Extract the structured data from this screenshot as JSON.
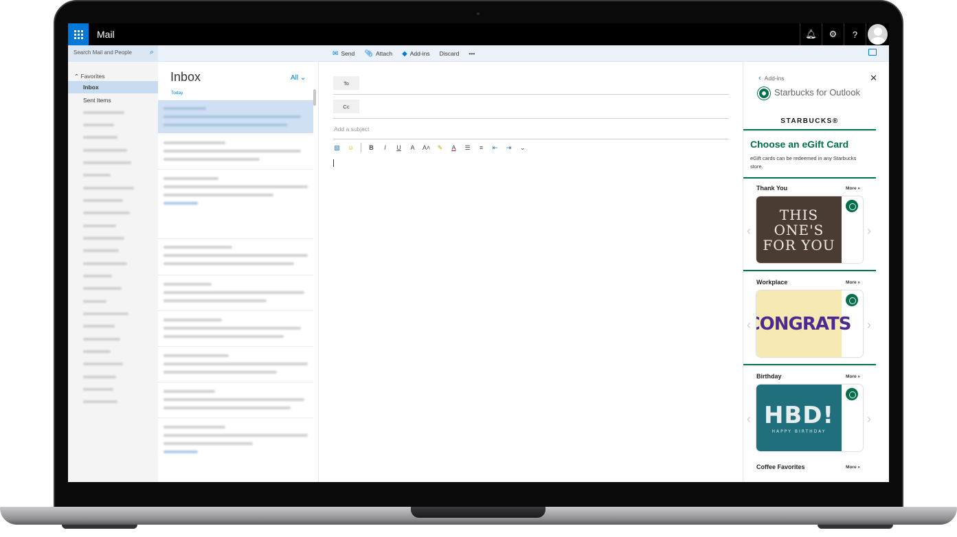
{
  "appbar": {
    "app_name": "Mail",
    "bell_icon": "bell-icon",
    "settings_icon": "gear-icon",
    "help_label": "?"
  },
  "search": {
    "placeholder": "Search Mail and People"
  },
  "commands": {
    "send": "Send",
    "attach": "Attach",
    "addins": "Add-ins",
    "discard": "Discard",
    "more": "•••"
  },
  "folders": {
    "favorites_label": "Favorites",
    "items": [
      {
        "label": "Inbox",
        "active": true
      },
      {
        "label": "Sent Items",
        "active": false
      }
    ]
  },
  "message_list": {
    "title": "Inbox",
    "filter": "All",
    "group_today": "Today"
  },
  "compose": {
    "to_label": "To",
    "cc_label": "Cc",
    "subject_placeholder": "Add a subject",
    "format_tools": [
      "insert-picture-icon",
      "emoji-icon",
      "bold",
      "italic",
      "underline",
      "font-size-icon",
      "grow-font-icon",
      "highlight-icon",
      "font-color-icon",
      "bullets-icon",
      "numbering-icon",
      "decrease-indent-icon",
      "increase-indent-icon",
      "more-options-chevron"
    ]
  },
  "addin": {
    "back_label": "Add-ins",
    "title": "Starbucks for Outlook",
    "brand": "STARBUCKS®",
    "hero_title": "Choose an eGift Card",
    "hero_subtitle": "eGift cards can be redeemed in any Starbucks store.",
    "categories": [
      {
        "name": "Thank You",
        "more": "More »"
      },
      {
        "name": "Workplace",
        "more": "More »"
      },
      {
        "name": "Birthday",
        "more": "More »"
      },
      {
        "name": "Coffee Favorites",
        "more": "More »"
      }
    ],
    "card_art": {
      "thanks": "THIS ONE'S FOR YOU",
      "congrats": "CONGRATS",
      "hbd": "HBD!",
      "hbd_small": "HAPPY BIRTHDAY"
    }
  },
  "colors": {
    "accent": "#0078d7",
    "starbucks_green": "#00704a",
    "appbar": "#000000"
  }
}
